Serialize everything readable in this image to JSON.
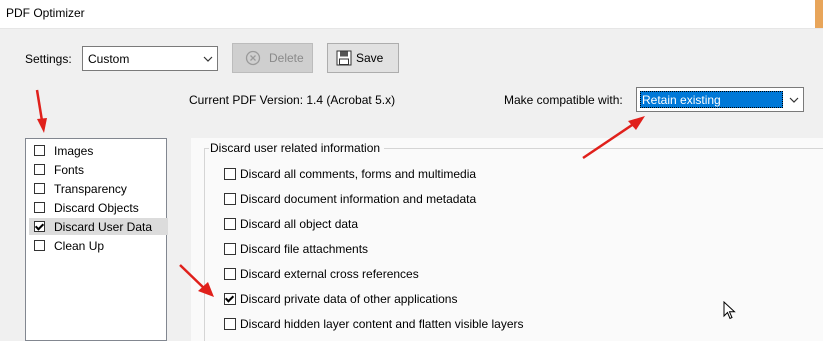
{
  "window": {
    "title": "PDF Optimizer"
  },
  "settings": {
    "label": "Settings:",
    "value": "Custom",
    "delete_label": "Delete",
    "save_label": "Save"
  },
  "version_text": "Current PDF Version: 1.4 (Acrobat 5.x)",
  "compat": {
    "label": "Make compatible with:",
    "value": "Retain existing"
  },
  "categories": [
    {
      "label": "Images",
      "checked": false,
      "selected": false
    },
    {
      "label": "Fonts",
      "checked": false,
      "selected": false
    },
    {
      "label": "Transparency",
      "checked": false,
      "selected": false
    },
    {
      "label": "Discard Objects",
      "checked": false,
      "selected": false
    },
    {
      "label": "Discard User Data",
      "checked": true,
      "selected": true
    },
    {
      "label": "Clean Up",
      "checked": false,
      "selected": false
    }
  ],
  "group": {
    "title": "Discard user related information",
    "options": [
      {
        "label": "Discard all comments, forms and multimedia",
        "checked": false
      },
      {
        "label": "Discard document information and metadata",
        "checked": false
      },
      {
        "label": "Discard all object data",
        "checked": false
      },
      {
        "label": "Discard file attachments",
        "checked": false
      },
      {
        "label": "Discard external cross references",
        "checked": false
      },
      {
        "label": "Discard private data of other applications",
        "checked": true
      },
      {
        "label": "Discard hidden layer content and flatten visible layers",
        "checked": false
      }
    ]
  },
  "colors": {
    "accent": "#0078d7",
    "annotation_arrow": "#e0201b"
  }
}
